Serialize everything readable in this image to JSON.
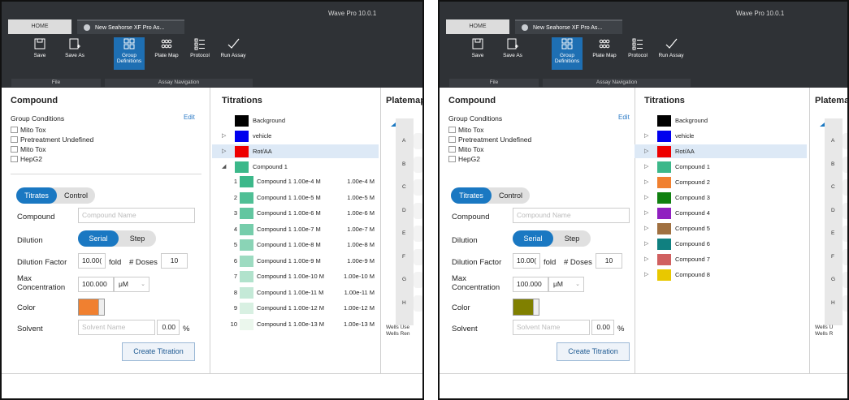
{
  "app_title": "Wave Pro 10.0.1",
  "tabs": {
    "home": "HOME",
    "document": "New Seahorse XF Pro As..."
  },
  "ribbon": {
    "save": "Save",
    "save_as": "Save As",
    "group_definitions": "Group Definitions",
    "plate_map": "Plate Map",
    "protocol": "Protocol",
    "run_assay": "Run Assay",
    "group_file": "File",
    "group_nav": "Assay Navigation"
  },
  "compound": {
    "title": "Compound",
    "group_conditions_label": "Group Conditions",
    "edit": "Edit",
    "conditions": [
      "Mito Tox",
      "Pretreatment Undefined",
      "Mito Tox",
      "HepG2"
    ],
    "toggle_titrates": "Titrates",
    "toggle_control": "Control",
    "compound_label": "Compound",
    "compound_placeholder": "Compound Name",
    "dilution_label": "Dilution",
    "dilution_serial": "Serial",
    "dilution_step": "Step",
    "dilution_factor_label": "Dilution Factor",
    "dilution_factor_value": "10.00(",
    "fold_label": "fold",
    "doses_label": "# Doses",
    "doses_value": "10",
    "max_conc_label": "Max Concentration",
    "max_conc_value": "100.000",
    "max_conc_unit": "μM",
    "color_label": "Color",
    "solvent_label": "Solvent",
    "solvent_placeholder": "Solvent Name",
    "solvent_percent": "0.00",
    "percent_sign": "%",
    "create_button": "Create Titration"
  },
  "titrations_title": "Titrations",
  "platemap_left_title": "Platemap",
  "platemap_right_title": "Platema",
  "plate_rows": [
    "A",
    "B",
    "C",
    "D",
    "E",
    "F",
    "G",
    "H"
  ],
  "left_plate_notes": [
    "Wells Use",
    "Wells Ren"
  ],
  "right_plate_notes": [
    "Wells U",
    "Wells R"
  ],
  "left_color_hex": "#f08030",
  "right_color_hex": "#808000",
  "left_titrations": [
    {
      "name": "Background",
      "color": "#000000",
      "expander": ""
    },
    {
      "name": "vehicle",
      "color": "#0000ee",
      "expander": "▷"
    },
    {
      "name": "Rot/AA",
      "color": "#ee0000",
      "expander": "▷"
    },
    {
      "name": "Compound 1",
      "color": "#3cb88a",
      "expander": "◢"
    }
  ],
  "left_compound_rows": [
    {
      "num": "1",
      "label": "Compound 1 1.00e-4 M",
      "conc": "1.00e-4 M",
      "color": "#3cb88a"
    },
    {
      "num": "2",
      "label": "Compound 1 1.00e-5 M",
      "conc": "1.00e-5 M",
      "color": "#4fbf95"
    },
    {
      "num": "3",
      "label": "Compound 1 1.00e-6 M",
      "conc": "1.00e-6 M",
      "color": "#62c6a0"
    },
    {
      "num": "4",
      "label": "Compound 1 1.00e-7 M",
      "conc": "1.00e-7 M",
      "color": "#76cdab"
    },
    {
      "num": "5",
      "label": "Compound 1 1.00e-8 M",
      "conc": "1.00e-8 M",
      "color": "#8ad4b6"
    },
    {
      "num": "6",
      "label": "Compound 1 1.00e-9 M",
      "conc": "1.00e-9 M",
      "color": "#9ddbc1"
    },
    {
      "num": "7",
      "label": "Compound 1 1.00e-10 M",
      "conc": "1.00e-10 M",
      "color": "#b1e2cc"
    },
    {
      "num": "8",
      "label": "Compound 1 1.00e-11 M",
      "conc": "1.00e-11 M",
      "color": "#c4e9d7"
    },
    {
      "num": "9",
      "label": "Compound 1 1.00e-12 M",
      "conc": "1.00e-12 M",
      "color": "#d8f0e2"
    },
    {
      "num": "10",
      "label": "Compound 1 1.00e-13 M",
      "conc": "1.00e-13 M",
      "color": "#ebf7ed"
    }
  ],
  "right_titrations": [
    {
      "name": "Background",
      "color": "#000000",
      "expander": ""
    },
    {
      "name": "vehicle",
      "color": "#0000ee",
      "expander": "▷"
    },
    {
      "name": "Rot/AA",
      "color": "#ee0000",
      "expander": "▷"
    },
    {
      "name": "Compound 1",
      "color": "#3cb88a",
      "expander": "▷"
    },
    {
      "name": "Compound 2",
      "color": "#f08030",
      "expander": "▷"
    },
    {
      "name": "Compound 3",
      "color": "#108010",
      "expander": "▷"
    },
    {
      "name": "Compound 4",
      "color": "#9020c0",
      "expander": "▷"
    },
    {
      "name": "Compound 5",
      "color": "#a07040",
      "expander": "▷"
    },
    {
      "name": "Compound 6",
      "color": "#108080",
      "expander": "▷"
    },
    {
      "name": "Compound 7",
      "color": "#d06060",
      "expander": "▷"
    },
    {
      "name": "Compound 8",
      "color": "#e8c800",
      "expander": "▷"
    }
  ]
}
